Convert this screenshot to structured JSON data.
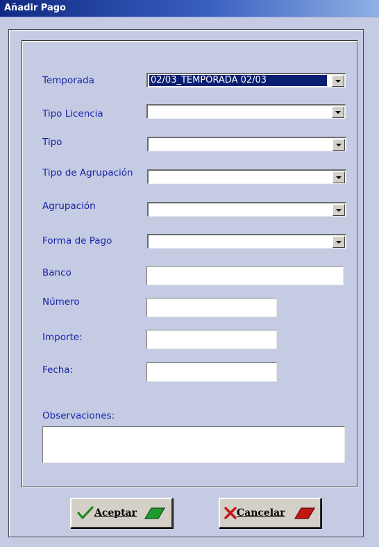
{
  "window": {
    "title": "Añadir Pago"
  },
  "form": {
    "temporada": {
      "label": "Temporada",
      "value": "02/03_TEMPORADA 02/03"
    },
    "tipo_licencia": {
      "label": "Tipo Licencia",
      "value": ""
    },
    "tipo": {
      "label": "Tipo",
      "value": ""
    },
    "tipo_agrupacion": {
      "label": "Tipo de Agrupación",
      "value": ""
    },
    "agrupacion": {
      "label": "Agrupación",
      "value": ""
    },
    "forma_pago": {
      "label": "Forma de Pago",
      "value": ""
    },
    "banco": {
      "label": "Banco",
      "value": ""
    },
    "numero": {
      "label": "Número",
      "value": ""
    },
    "importe": {
      "label": "Importe:",
      "value": ""
    },
    "fecha": {
      "label": "Fecha:",
      "value": ""
    },
    "observaciones": {
      "label": "Observaciones:",
      "value": ""
    }
  },
  "buttons": {
    "accept": {
      "label": "Aceptar",
      "icon": "check-icon",
      "color": "#1f8a1f"
    },
    "cancel": {
      "label": "Cancelar",
      "icon": "x-icon",
      "color": "#c41515"
    }
  },
  "colors": {
    "background": "#c4cbe3",
    "label": "#1a23a6",
    "selection": "#0b1f72"
  }
}
